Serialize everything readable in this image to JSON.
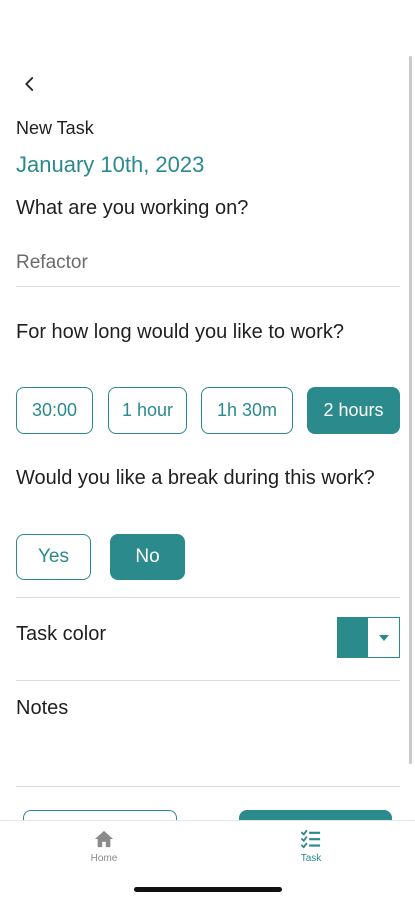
{
  "header": {
    "title": "New Task",
    "date": "January 10th, 2023"
  },
  "task": {
    "question": "What are you working on?",
    "value": "Refactor",
    "placeholder": ""
  },
  "duration": {
    "question": "For how long would you like to work?",
    "options": [
      "30:00",
      "1 hour",
      "1h 30m",
      "2 hours"
    ],
    "selected": "2 hours"
  },
  "break": {
    "question": "Would you like a break during this work?",
    "options": [
      "Yes",
      "No"
    ],
    "selected": "No"
  },
  "color": {
    "label": "Task color",
    "value": "#2b8a8c"
  },
  "notes": {
    "label": "Notes"
  },
  "nav": {
    "items": [
      {
        "label": "Home",
        "icon": "home-icon",
        "active": false
      },
      {
        "label": "Task",
        "icon": "task-list-icon",
        "active": true
      }
    ]
  },
  "theme": {
    "accent": "#2b8a8c",
    "muted": "#8a8a8a"
  }
}
